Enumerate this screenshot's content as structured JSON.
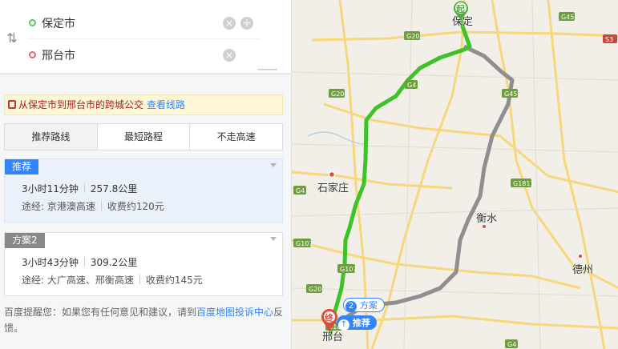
{
  "route": {
    "origin": "保定市",
    "destination": "邢台市"
  },
  "bus_tip": {
    "text": "从保定市到邢台市的跨城公交",
    "link": "查看线路"
  },
  "tabs": [
    {
      "label": "推荐路线",
      "active": true
    },
    {
      "label": "最短路程",
      "active": false
    },
    {
      "label": "不走高速",
      "active": false
    }
  ],
  "plans": [
    {
      "tag": "推荐",
      "time": "3小时11分钟",
      "distance": "257.8公里",
      "via_prefix": "途经:",
      "via": "京港澳高速",
      "toll": "收费约120元"
    },
    {
      "tag": "方案2",
      "time": "3小时43分钟",
      "distance": "309.2公里",
      "via_prefix": "途经:",
      "via": "大广高速、邢衡高速",
      "toll": "收费约145元"
    }
  ],
  "notice": {
    "prefix": "百度提醒您：如果您有任何意见和建议，请到",
    "link": "百度地图投诉中心",
    "suffix": "反馈。"
  },
  "map": {
    "cities": {
      "baoding": "保定",
      "shijiazhuang": "石家庄",
      "hengshui": "衡水",
      "dezhou": "德州",
      "xingtai": "邢台"
    },
    "road_labels": [
      "G45",
      "G20",
      "G4",
      "S3",
      "G45",
      "G20",
      "G1811",
      "G107",
      "G20",
      "G4",
      "G107",
      "G107",
      "G4"
    ],
    "markers": {
      "start": "起",
      "end": "终",
      "plan2_num": "2",
      "plan2_label": "方案",
      "recommend_label": "推荐"
    },
    "colors": {
      "recommended_route": "#3ec22a",
      "alternative_route": "#9a9a9a",
      "start_marker": "#4cae3c",
      "end_marker": "#e04b3c",
      "accent": "#3385ff"
    }
  }
}
